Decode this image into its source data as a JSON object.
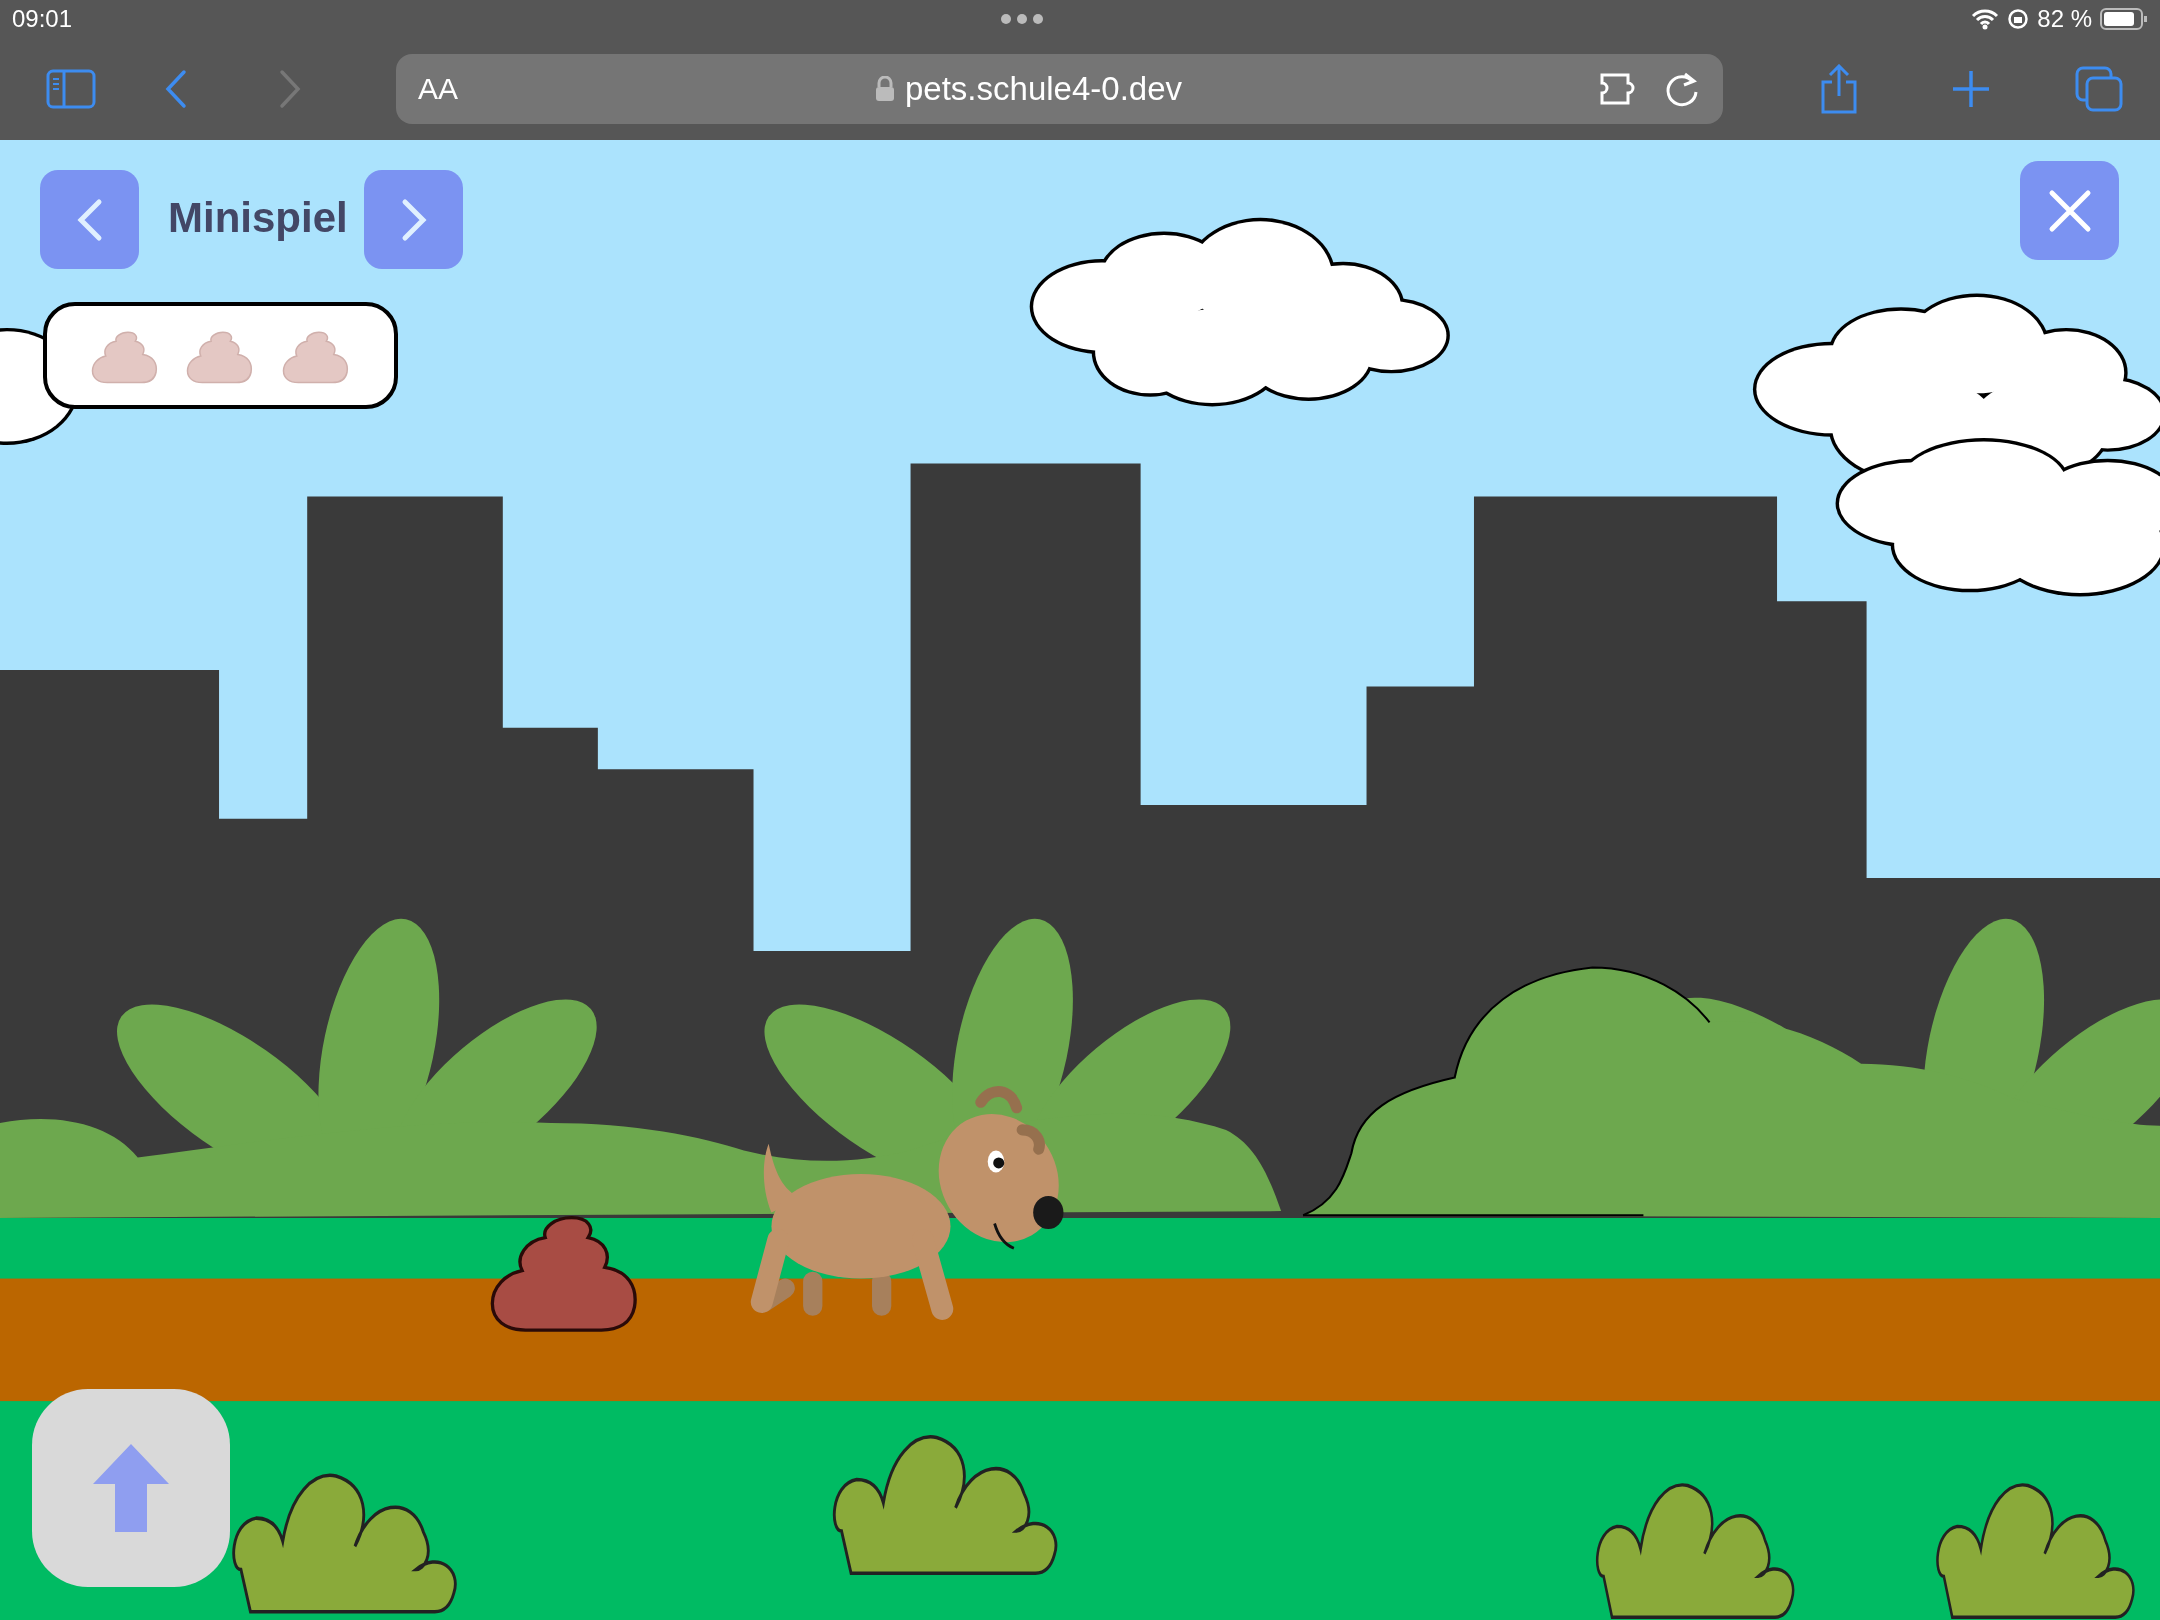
{
  "status_bar": {
    "time": "09:01",
    "battery": "82 %"
  },
  "browser_toolbar": {
    "text_size_button": "AA",
    "url": "pets.schule4-0.dev"
  },
  "game": {
    "title": "Minispiel",
    "poop_counter": [
      {
        "collected": false
      },
      {
        "collected": false
      },
      {
        "collected": false
      }
    ]
  }
}
